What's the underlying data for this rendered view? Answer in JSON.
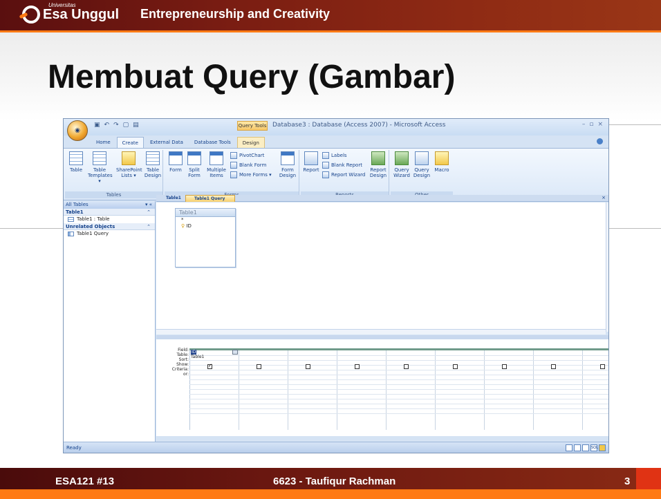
{
  "slide": {
    "logo_small": "Universitas",
    "logo": "Esa Unggul",
    "course": "Entrepreneurship and Creativity",
    "title": "Membuat Query (Gambar)",
    "footer_left": "ESA121 #13",
    "footer_center": "6623 - Taufiqur Rachman",
    "footer_page": "3"
  },
  "access": {
    "context_tab": "Query Tools",
    "caption": "Database3 : Database (Access 2007) - Microsoft Access",
    "tabs": [
      "Home",
      "Create",
      "External Data",
      "Database Tools",
      "Design"
    ],
    "groups": {
      "tables": {
        "name": "Tables",
        "buttons": [
          "Table",
          "Table Templates ▾",
          "SharePoint Lists ▾",
          "Table Design"
        ]
      },
      "forms": {
        "name": "Forms",
        "buttons": [
          "Form",
          "Split Form",
          "Multiple Items",
          "PivotChart",
          "Blank Form",
          "More Forms ▾",
          "Form Design"
        ]
      },
      "reports": {
        "name": "Reports",
        "buttons": [
          "Report",
          "Labels",
          "Blank Report",
          "Report Wizard",
          "Report Design"
        ]
      },
      "other": {
        "name": "Other",
        "buttons": [
          "Query Wizard",
          "Query Design",
          "Macro"
        ]
      }
    },
    "nav": {
      "header": "All Tables",
      "group1": "Table1",
      "item1": "Table1 : Table",
      "group2": "Unrelated Objects",
      "item2": "Table1 Query"
    },
    "doc_tabs": [
      "Table1",
      "Table1 Query"
    ],
    "table_box": {
      "title": "Table1",
      "star": "*",
      "field": "ID"
    },
    "grid": {
      "row_labels": [
        "Field:",
        "Table:",
        "Sort:",
        "Show:",
        "Criteria:",
        "or:"
      ],
      "field_value": "ID",
      "table_value": "Table1"
    },
    "status": "Ready"
  }
}
